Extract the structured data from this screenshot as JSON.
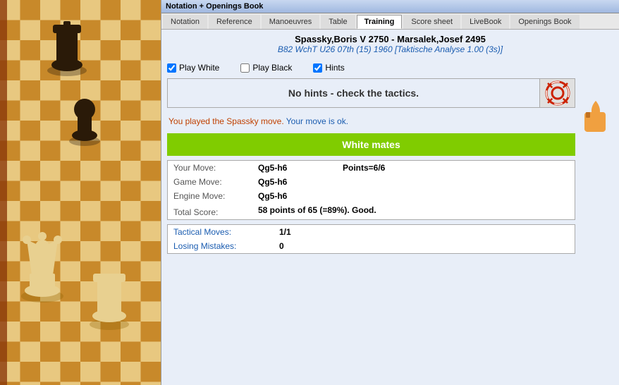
{
  "titleBar": {
    "label": "Notation + Openings Book"
  },
  "tabs": [
    {
      "id": "notation",
      "label": "Notation",
      "active": false
    },
    {
      "id": "reference",
      "label": "Reference",
      "active": false
    },
    {
      "id": "manoeuvres",
      "label": "Manoeuvres",
      "active": false
    },
    {
      "id": "table",
      "label": "Table",
      "active": false
    },
    {
      "id": "training",
      "label": "Training",
      "active": true
    },
    {
      "id": "scoresheet",
      "label": "Score sheet",
      "active": false
    },
    {
      "id": "livebook",
      "label": "LiveBook",
      "active": false
    },
    {
      "id": "openingsbook",
      "label": "Openings Book",
      "active": false
    }
  ],
  "match": {
    "title": "Spassky,Boris V 2750 - Marsalek,Josef 2495",
    "subtitle_plain": "B82  WchT U26 07th (15) 1960 ",
    "subtitle_italic": "[Taktische Analyse 1.00 (3s)]"
  },
  "checkboxes": {
    "play_white": {
      "label": "Play White",
      "checked": true
    },
    "play_black": {
      "label": "Play Black",
      "checked": false
    },
    "hints": {
      "label": "Hints",
      "checked": true
    }
  },
  "hint": {
    "text": "No hints - check the tactics."
  },
  "feedback": {
    "part1": "You played the Spassky move. ",
    "part2": "Your move is ok."
  },
  "matesBar": {
    "text": "White mates"
  },
  "scoreData": {
    "your_move_label": "Your Move:",
    "your_move_value": "Qg5-h6",
    "your_move_points": "Points=6/6",
    "game_move_label": "Game Move:",
    "game_move_value": "Qg5-h6",
    "engine_move_label": "Engine Move:",
    "engine_move_value": "Qg5-h6",
    "total_score_label": "Total Score:",
    "total_score_value": "58 points of 65 (=89%). Good."
  },
  "statsData": {
    "tactical_moves_label": "Tactical Moves:",
    "tactical_moves_value": "1/1",
    "losing_mistakes_label": "Losing Mistakes:",
    "losing_mistakes_value": "0"
  }
}
